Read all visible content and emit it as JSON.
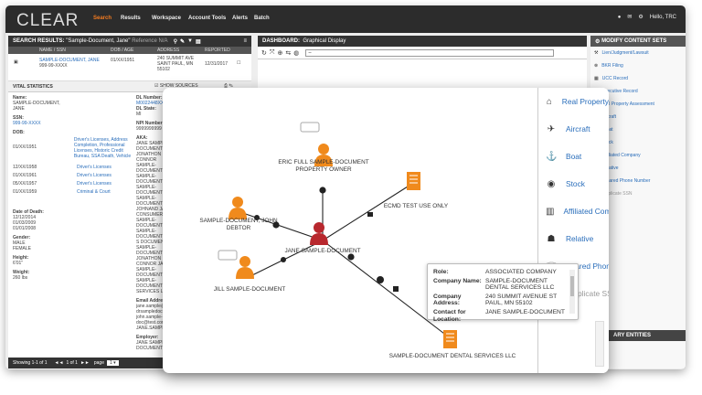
{
  "app": {
    "logo": "CLEAR",
    "nav": [
      "Search",
      "Results",
      "Workspace",
      "Account Tools",
      "Alerts",
      "Batch"
    ],
    "user": "Hello, TRC"
  },
  "search": {
    "title": "SEARCH RESULTS:",
    "query": "\"Sample-Document, Jane\"",
    "ref": "Reference N/A",
    "cols": [
      "NAME / SSN",
      "DOB / AGE",
      "ADDRESS",
      "REPORTED"
    ],
    "row": {
      "name": "SAMPLE-DOCUMENT, JANE",
      "ssn": "999-99-XXXX",
      "dob": "01/XX/1951",
      "address": "240 SUMMIT AVE SAINT PAUL, MN 55102",
      "reported": "12/31/2017"
    }
  },
  "vital": {
    "title": "VITAL STATISTICS",
    "show_sources": "SHOW SOURCES",
    "name_label": "Name:",
    "name": "SAMPLE-DOCUMENT, JANE",
    "ssn_label": "SSN:",
    "ssn": "999-99-XXXX",
    "dob_label": "DOB:",
    "dobs": [
      {
        "date": "01/XX/1951",
        "src": "Driver's Licenses, Address Completion, Professional Licenses, Historic Credit Bureau, SSA Death, Vehicle"
      },
      {
        "date": "12/XX/1958",
        "src": "Driver's Licenses"
      },
      {
        "date": "01/XX/1961",
        "src": "Driver's Licenses"
      },
      {
        "date": "05/XX/1957",
        "src": "Driver's Licenses"
      },
      {
        "date": "01/XX/1959",
        "src": "Criminal & Court"
      }
    ],
    "death_label": "Date of Death:",
    "deaths": [
      "12/12/2014",
      "01/03/2009",
      "01/01/2008"
    ],
    "gender_label": "Gender:",
    "genders": [
      "MALE",
      "FEMALE"
    ],
    "height_label": "Height:",
    "height": "6'01\"",
    "weight_label": "Weight:",
    "weight": "260 lbs",
    "dl_label": "DL Number:",
    "dl": "M0022448XXX",
    "dlstate_label": "DL State:",
    "dlstate": "MI",
    "npi_label": "NPI Number:",
    "npi": "9999999999",
    "aka_label": "AKA:",
    "akas": [
      "JANE SAMPLE-DOCUMENT",
      "JONATHON CONNOR",
      "SAMPLE-DOCUMENT JANE",
      "SAMPLE-DOCUMENT",
      "SAMPLE-DOCUMENT",
      "SAMPLE-DOCUMENT",
      "JOHNAND JANE",
      "CONSUMER, JOHN",
      "SAMPLE-DOCUMENT",
      "SAMPLE-DOCUMENT SUE",
      "S DOCUMENT, JANE",
      "SAMPLE-DOCUMENT",
      "JONATHON CONNOR JANE",
      "SAMPLE-DOCUMENT",
      "SAMPLE-DOCUMENT SERVICES LLC"
    ],
    "email_label": "Email Address:",
    "emails": [
      "jane.sample@test.com",
      "drsampledocument@test.com",
      "john.sample-doc@test.com",
      "JANE.SAMPLE@TEST.COM"
    ],
    "employer_label": "Employer:",
    "employer": "JANE SAMPLE-DOCUMENT"
  },
  "footer": {
    "showing": "Showing 1-1 of 1",
    "pager": "1 of 1",
    "page": "page"
  },
  "dashboard": {
    "title": "DASHBOARD:",
    "subtitle": "Graphical Display",
    "select": "--"
  },
  "modify": {
    "title": "MODIFY CONTENT SETS",
    "items": [
      "Lien/Judgment/Lawsuit",
      "BKR Filing",
      "UCC Record",
      "Executive Record",
      "Real Property Assessment",
      "Aircraft",
      "Boat",
      "Stock",
      "Affiliated Company",
      "Relative",
      "Shared Phone Number",
      "Duplicate SSN"
    ],
    "bottom": "ARY ENTITIES"
  },
  "graph": {
    "nodes": {
      "eric": "ERIC FULL SAMPLE-DOCUMENT PROPERTY OWNER",
      "john": "SAMPLE-DOCUMENT, JOHN DEBTOR",
      "ecmd": "ECMD TEST USE ONLY",
      "jane": "JANE SAMPLE-DOCUMENT",
      "jill": "JILL SAMPLE-DOCUMENT",
      "company": "SAMPLE-DOCUMENT DENTAL SERVICES LLC"
    }
  },
  "panel": {
    "items": [
      "Real Property",
      "Aircraft",
      "Boat",
      "Stock",
      "Affiliated Company",
      "Relative",
      "Shared Phone",
      "Duplicate SSN"
    ],
    "ssn_badge": "SSN"
  },
  "tooltip": {
    "role_label": "Role:",
    "role": "ASSOCIATED COMPANY",
    "company_label": "Company Name:",
    "company": "SAMPLE-DOCUMENT DENTAL SERVICES LLC",
    "address_label": "Company Address:",
    "address": "240 SUMMIT AVENUE ST PAUL, MN 55102",
    "contact_label": "Contact for Location:",
    "contact": "JANE SAMPLE-DOCUMENT"
  },
  "colors": {
    "accent": "#f47b20",
    "person_orange": "#f08a1c",
    "person_red": "#b8282e",
    "link": "#2a6ebb",
    "dark": "#2c2c2c"
  }
}
